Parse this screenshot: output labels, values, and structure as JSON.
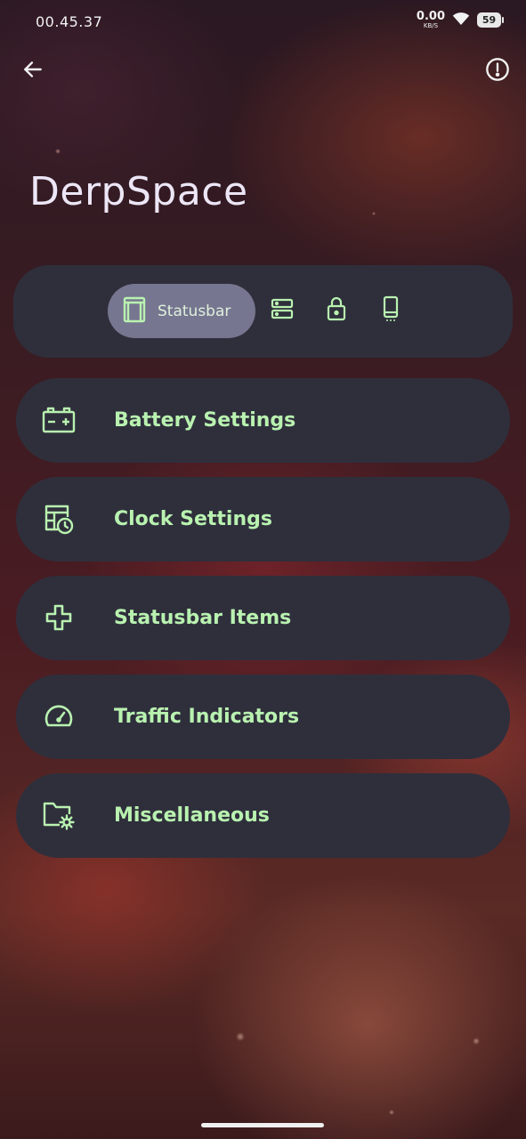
{
  "status_bar": {
    "time": "00.45.37",
    "net_speed_value": "0.00",
    "net_speed_unit": "KB/S",
    "battery_level": "59"
  },
  "header": {
    "title": "DerpSpace",
    "back_icon": "arrow-left-icon",
    "info_icon": "info-icon"
  },
  "tabs": {
    "active_label": "Statusbar",
    "items": [
      {
        "icon": "statusbar-icon",
        "label": "Statusbar",
        "active": true
      },
      {
        "icon": "quick-settings-icon",
        "active": false
      },
      {
        "icon": "lock-icon",
        "active": false
      },
      {
        "icon": "phone-icon",
        "active": false
      }
    ]
  },
  "menu": {
    "items": [
      {
        "icon": "battery-plus-icon",
        "label": "Battery Settings"
      },
      {
        "icon": "calendar-clock-icon",
        "label": "Clock Settings"
      },
      {
        "icon": "plus-outline-icon",
        "label": "Statusbar Items"
      },
      {
        "icon": "speedometer-icon",
        "label": "Traffic Indicators"
      },
      {
        "icon": "folder-settings-icon",
        "label": "Miscellaneous"
      }
    ]
  },
  "colors": {
    "accent_green": "#b9f2b0",
    "card_background": "#2f2f3c",
    "active_tab": "#767690"
  }
}
